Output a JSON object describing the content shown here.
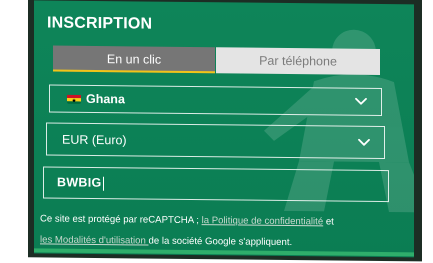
{
  "form": {
    "title": "INSCRIPTION",
    "tabs": [
      {
        "label": "En un clic",
        "active": true
      },
      {
        "label": "Par téléphone",
        "active": false
      }
    ],
    "country": {
      "value": "Ghana",
      "icon": "ghana-flag-icon"
    },
    "currency": {
      "value": "EUR (Euro)"
    },
    "promo_code": {
      "value": "BWBIG"
    },
    "recaptcha": {
      "part1": "Ce site est protégé par reCAPTCHA ; ",
      "link1": "la Politique de confidentialité",
      "part2": " et ",
      "link2": "les Modalités d'utilisation ",
      "part3": "de la société Google s'appliquent."
    }
  },
  "colors": {
    "background_green": "#0b7d53",
    "border_dark": "#1c2d24",
    "active_tab": "#767676",
    "inactive_tab": "#e4e4e4",
    "active_tab_underline": "#f0c419",
    "link": "#c9d9cf"
  }
}
